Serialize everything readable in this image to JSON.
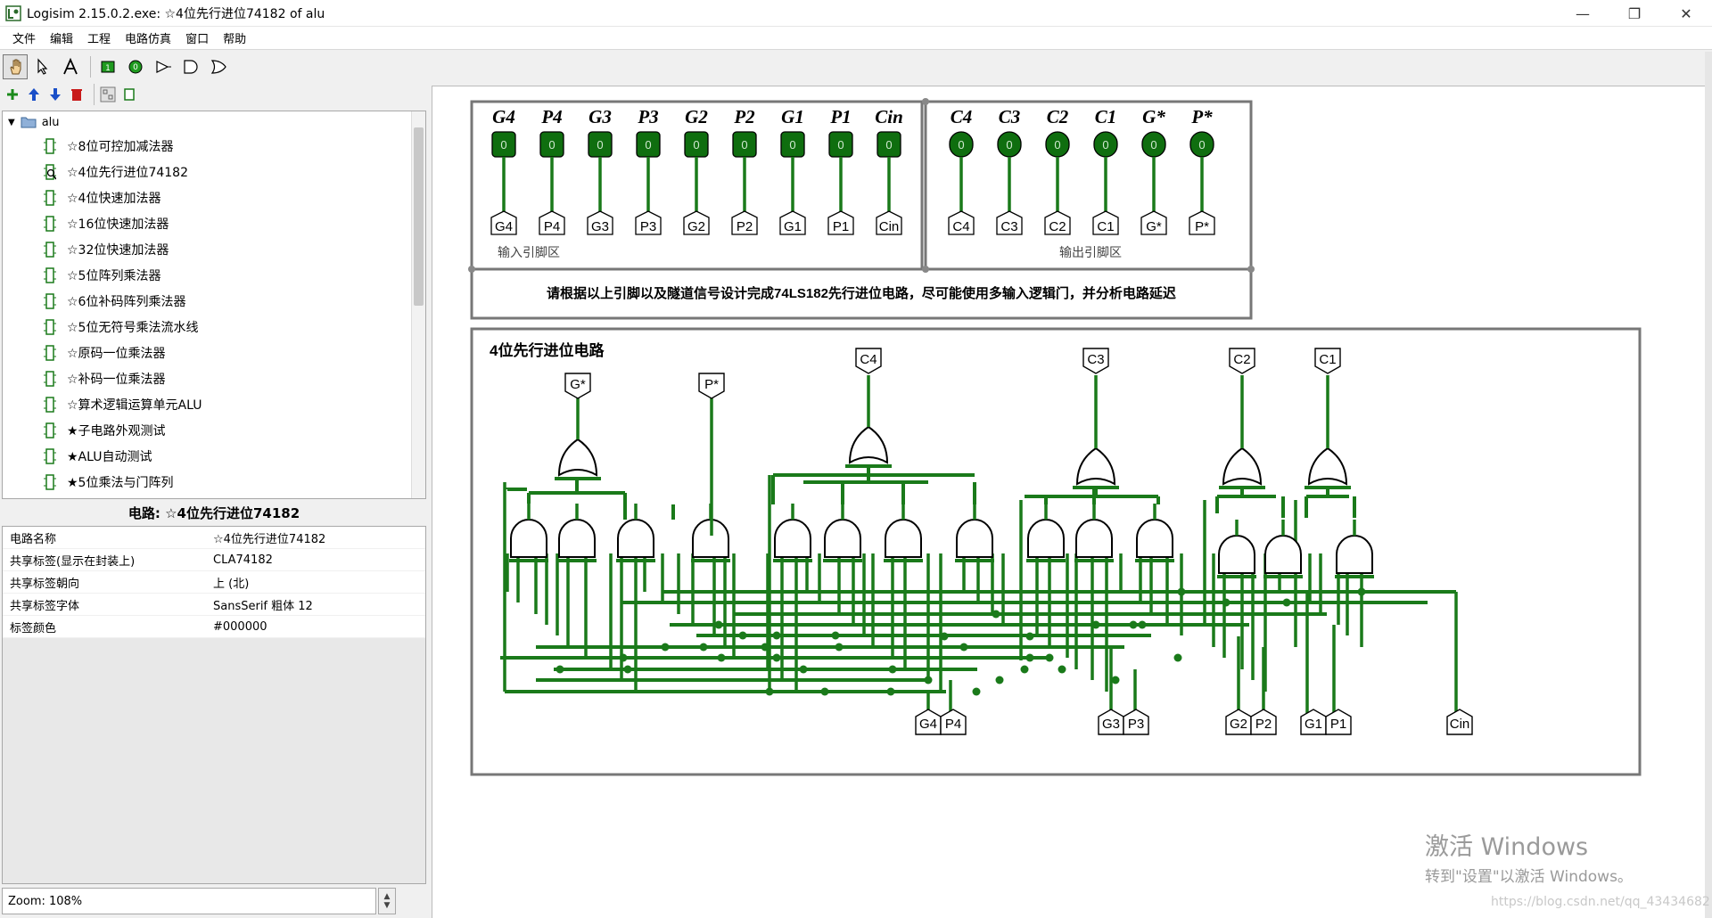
{
  "window": {
    "title": "Logisim 2.15.0.2.exe: ☆4位先行进位74182 of alu",
    "minimize": "—",
    "restore": "❐",
    "close": "✕"
  },
  "menu": [
    "文件",
    "编辑",
    "工程",
    "电路仿真",
    "窗口",
    "帮助"
  ],
  "toolbar_icons": [
    "hand-poke-icon",
    "pointer-icon",
    "text-tool-icon",
    "input-pin-icon",
    "output-pin-icon",
    "not-gate-icon",
    "and-gate-icon",
    "or-gate-icon"
  ],
  "toolbar2_icons": [
    "add-circuit-icon",
    "move-up-icon",
    "move-down-icon",
    "delete-circuit-icon",
    "layout-view-icon",
    "appearance-view-icon"
  ],
  "tree": {
    "root": "alu",
    "items": [
      "☆8位可控加减法器",
      "☆4位先行进位74182",
      "☆4位快速加法器",
      "☆16位快速加法器",
      "☆32位快速加法器",
      "☆5位阵列乘法器",
      "☆6位补码阵列乘法器",
      "☆5位无符号乘法流水线",
      "☆原码一位乘法器",
      "☆补码一位乘法器",
      "☆算术逻辑运算单元ALU",
      "★子电路外观测试",
      "★ALU自动测试",
      "★5位乘法与门阵列"
    ]
  },
  "attr_table": {
    "title": "电路: ☆4位先行进位74182",
    "rows": [
      {
        "key": "电路名称",
        "value": "☆4位先行进位74182"
      },
      {
        "key": "共享标签(显示在封装上)",
        "value": "CLA74182"
      },
      {
        "key": "共享标签朝向",
        "value": "上 (北)"
      },
      {
        "key": "共享标签字体",
        "value": "SansSerif 粗体 12"
      },
      {
        "key": "标签颜色",
        "value": "#000000"
      }
    ]
  },
  "zoom": "Zoom: 108%",
  "circuit": {
    "input_headers": [
      "G4",
      "P4",
      "G3",
      "P3",
      "G2",
      "P2",
      "G1",
      "P1",
      "Cin"
    ],
    "input_tunnels": [
      "G4",
      "P4",
      "G3",
      "P3",
      "G2",
      "P2",
      "G1",
      "P1",
      "Cin"
    ],
    "output_headers": [
      "C4",
      "C3",
      "C2",
      "C1",
      "G*",
      "P*"
    ],
    "output_tunnels": [
      "C4",
      "C3",
      "C2",
      "C1",
      "G*",
      "P*"
    ],
    "pin_value": "0",
    "input_area_label": "输入引脚区",
    "output_area_label": "输出引脚区",
    "instruction": "请根据以上引脚以及隧道信号设计完成74LS182先行进位电路，尽可能使用多输入逻辑门，并分析电路延迟",
    "main_title": "4位先行进位电路",
    "top_tunnels": [
      "G*",
      "P*",
      "C4",
      "C3",
      "C2",
      "C1"
    ],
    "bottom_tunnels": [
      "G4",
      "P4",
      "G3",
      "P3",
      "G2",
      "P2",
      "G1",
      "P1",
      "Cin"
    ],
    "wire_color": "#1a7a1a",
    "pin_color": "#0f6e0f"
  },
  "watermark": {
    "line1": "激活 Windows",
    "line2": "转到\"设置\"以激活 Windows。"
  },
  "blog_url": "https://blog.csdn.net/qq_43434682"
}
